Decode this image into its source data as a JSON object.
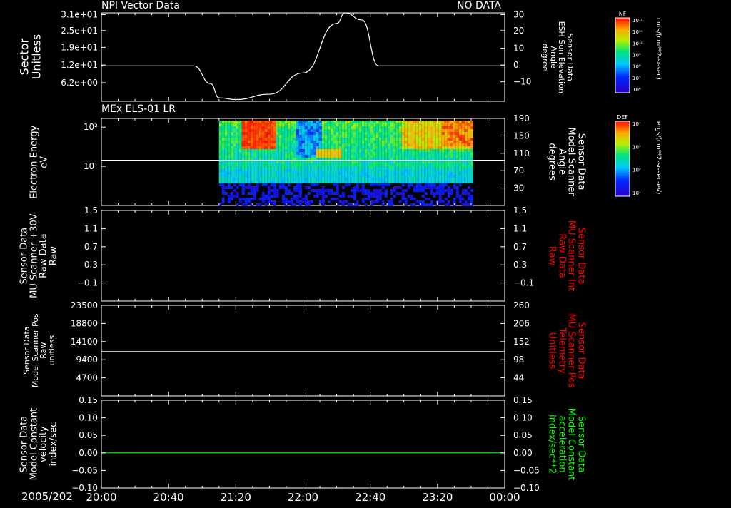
{
  "header": {
    "panel1_title": "NPI Vector Data",
    "panel1_status": "NO DATA",
    "panel2_title": "MEx ELS-01 LR"
  },
  "x_axis": {
    "date_label": "2005/202",
    "ticks": [
      "20:00",
      "20:40",
      "21:20",
      "22:00",
      "22:40",
      "23:20",
      "00:00"
    ]
  },
  "colorbars": [
    {
      "title": "NF",
      "unit": "cnts/(cm**2-sr-sec)",
      "ticks": [
        "10¹²",
        "10¹¹",
        "10¹⁰",
        "10⁹",
        "10⁸",
        "10⁷",
        "10⁶"
      ]
    },
    {
      "title": "DEF",
      "unit": "ergs/(cm**2-sr-sec-eV)",
      "ticks": [
        "10⁴",
        "10³",
        "10²",
        "10¹"
      ]
    }
  ],
  "panels": [
    {
      "left_label": "Sector\nUnitless",
      "right_label": "Sensor Data\nESH Sun Elevation\nAngle\ndegree",
      "right_label_color": "#ffffff",
      "left_ticks": [
        "3.1e+01",
        "2.5e+01",
        "1.9e+01",
        "1.2e+01",
        "6.2e+00"
      ],
      "right_ticks": [
        "30",
        "20",
        "10",
        "0",
        "−10"
      ]
    },
    {
      "left_label": "Electron Energy\neV",
      "right_label": "Sensor Data\nModel Scanner\nAngle\ndegrees",
      "right_label_color": "#ffffff",
      "left_ticks": [
        "10²",
        "10¹"
      ],
      "right_ticks": [
        "190",
        "150",
        "110",
        "70",
        "30"
      ]
    },
    {
      "left_label": "Sensor Data\nMU Scanner +30V\nRaw Data\nRaw",
      "right_label": "Sensor Data\nMU Scanner Int\nRaw Data\nRaw",
      "right_label_color": "#ff0000",
      "left_ticks": [
        "1.5",
        "1.1",
        "0.7",
        "0.3",
        "−0.1"
      ],
      "right_ticks": [
        "1.5",
        "1.1",
        "0.7",
        "0.3",
        "−0.1"
      ]
    },
    {
      "left_label": "Sensor Data\nModel Scanner Pos\nRaw\nunitless",
      "right_label": "Sensor Data\nMU Scanner Pos\nTelemetry\nUnitless",
      "right_label_color": "#ff0000",
      "left_ticks": [
        "23500",
        "18800",
        "14100",
        "9400",
        "4700"
      ],
      "right_ticks": [
        "260",
        "206",
        "152",
        "98",
        "44"
      ]
    },
    {
      "left_label": "Sensor Data\nModel Constant\nvelocity\nindex/sec",
      "right_label": "Sensor Data\nModel Constant\nacceleration\nindex/sec**2",
      "right_label_color": "#00ff00",
      "left_ticks": [
        "0.15",
        "0.10",
        "0.05",
        "0.00",
        "−0.05",
        "−0.10"
      ],
      "right_ticks": [
        "0.15",
        "0.10",
        "0.05",
        "0.00",
        "−0.05",
        "−0.10"
      ]
    }
  ],
  "chart_data": [
    {
      "type": "line",
      "series": [
        {
          "color": "#ffffff",
          "x": [
            "20:00",
            "20:55",
            "21:05",
            "21:10",
            "21:20",
            "21:40",
            "22:00",
            "22:20",
            "22:25",
            "22:35",
            "22:45",
            "00:00"
          ],
          "y": [
            0,
            0,
            -10,
            -18,
            -19,
            -16,
            -4,
            24,
            30,
            26,
            0,
            0
          ]
        }
      ],
      "right_axis": {
        "unit": "degree",
        "ticks": [
          30,
          20,
          10,
          0,
          -10
        ],
        "range": [
          -20,
          30
        ]
      }
    },
    {
      "type": "heatmap",
      "x_range": [
        "21:10",
        "23:40"
      ],
      "y_scale": "log",
      "y_ticks": [
        "10²",
        "10¹"
      ],
      "overlay_line": {
        "color": "#ffffff"
      },
      "right_axis": {
        "ticks": [
          190,
          150,
          110,
          70,
          30
        ]
      }
    },
    {
      "type": "line",
      "left_axis": {
        "ticks": [
          1.5,
          1.1,
          0.7,
          0.3,
          -0.1
        ]
      },
      "right_axis": {
        "ticks": [
          1.5,
          1.1,
          0.7,
          0.3,
          -0.1
        ]
      },
      "series": []
    },
    {
      "type": "line",
      "left_axis": {
        "ticks": [
          23500,
          18800,
          14100,
          9400,
          4700
        ],
        "range": [
          0,
          23500
        ]
      },
      "right_axis": {
        "ticks": [
          260,
          206,
          152,
          98,
          44
        ]
      },
      "series": [
        {
          "color": "#ffffff",
          "x": [
            "20:00",
            "00:00"
          ],
          "y": [
            11500,
            11500
          ]
        }
      ]
    },
    {
      "type": "line",
      "left_axis": {
        "ticks": [
          0.15,
          0.1,
          0.05,
          0.0,
          -0.05,
          -0.1
        ],
        "range": [
          -0.1,
          0.15
        ]
      },
      "right_axis": {
        "ticks": [
          0.15,
          0.1,
          0.05,
          0.0,
          -0.05,
          -0.1
        ]
      },
      "series": [
        {
          "color": "#00ff00",
          "x": [
            "20:00",
            "00:00"
          ],
          "y": [
            0.0,
            0.0
          ]
        }
      ]
    }
  ]
}
